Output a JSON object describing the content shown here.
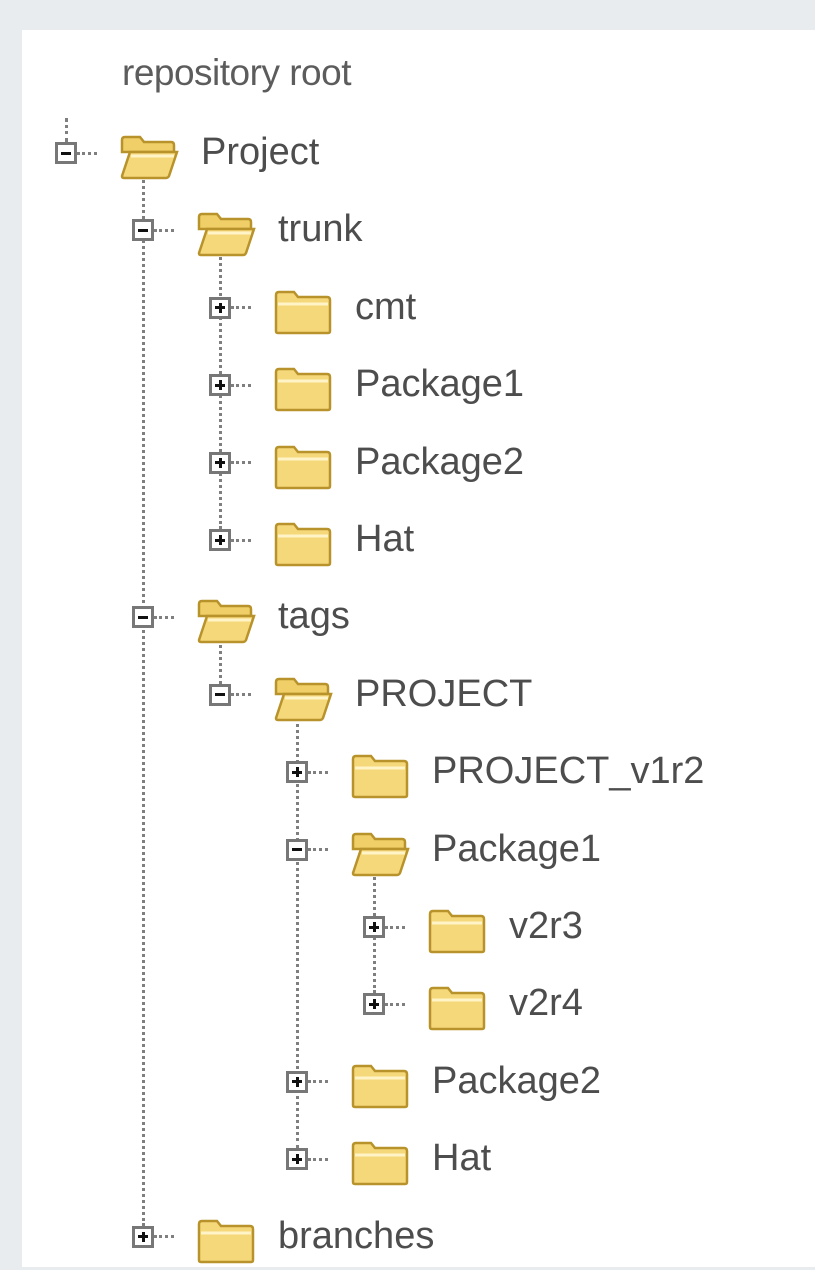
{
  "tree": {
    "root_label": "repository root",
    "nodes": [
      {
        "label": "Project",
        "depth": 0,
        "expanded": true
      },
      {
        "label": "trunk",
        "depth": 1,
        "expanded": true
      },
      {
        "label": "cmt",
        "depth": 2,
        "expanded": false
      },
      {
        "label": "Package1",
        "depth": 2,
        "expanded": false
      },
      {
        "label": "Package2",
        "depth": 2,
        "expanded": false
      },
      {
        "label": "Hat",
        "depth": 2,
        "expanded": false
      },
      {
        "label": "tags",
        "depth": 1,
        "expanded": true
      },
      {
        "label": "PROJECT",
        "depth": 2,
        "expanded": true
      },
      {
        "label": "PROJECT_v1r2",
        "depth": 3,
        "expanded": false
      },
      {
        "label": "Package1",
        "depth": 3,
        "expanded": true
      },
      {
        "label": "v2r3",
        "depth": 4,
        "expanded": false
      },
      {
        "label": "v2r4",
        "depth": 4,
        "expanded": false
      },
      {
        "label": "Package2",
        "depth": 3,
        "expanded": false
      },
      {
        "label": "Hat",
        "depth": 3,
        "expanded": false
      },
      {
        "label": "branches",
        "depth": 1,
        "expanded": false
      }
    ]
  },
  "icons": {
    "expanded_toggle": "minus-box-icon",
    "collapsed_toggle": "plus-box-icon",
    "open_folder": "folder-open-icon",
    "closed_folder": "folder-closed-icon"
  },
  "colors": {
    "background": "#e9ecef",
    "panel": "#ffffff",
    "text": "#4d4d4d",
    "connector": "#7f7f7f",
    "folder_fill": "#f5d87a",
    "folder_stroke": "#b8922a"
  }
}
